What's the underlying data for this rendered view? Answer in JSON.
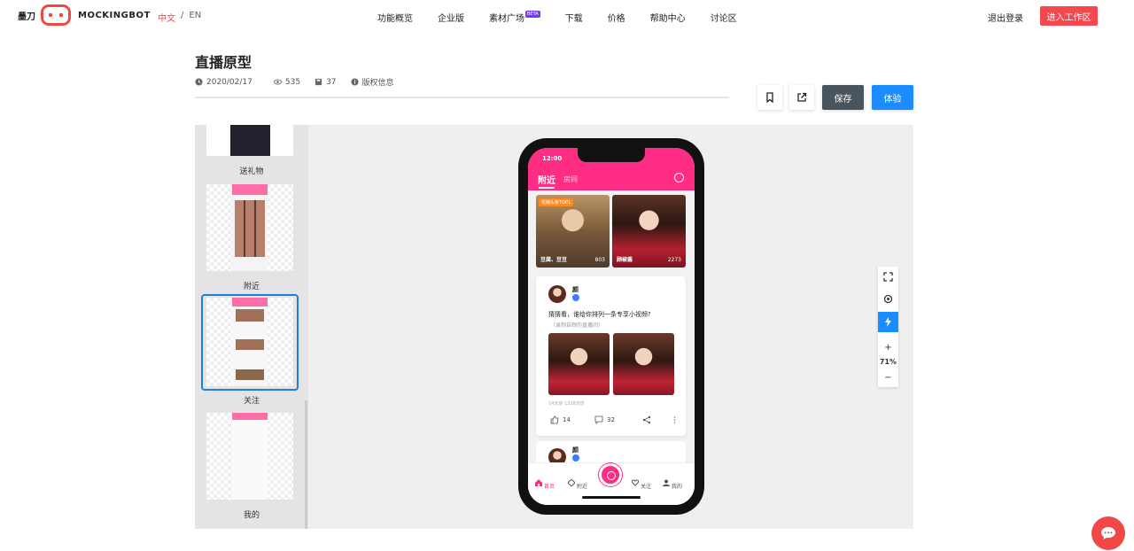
{
  "nav": {
    "logo_cn": "墨刀",
    "logo_en": "MOCKINGBOT",
    "lang_cn": "中文",
    "lang_sep": "/",
    "lang_en": "EN",
    "menu": [
      "功能概览",
      "企业版",
      "素材广场",
      "下载",
      "价格",
      "帮助中心",
      "讨论区"
    ],
    "beta": "BETA",
    "logout": "退出登录",
    "enter": "进入工作区"
  },
  "project": {
    "title": "直播原型",
    "date": "2020/02/17",
    "views": "535",
    "saves": "37",
    "copyright": "版权信息",
    "save_label": "保存",
    "try_label": "体验"
  },
  "sidebar": {
    "pages": [
      "送礼物",
      "附近",
      "关注",
      "我的"
    ],
    "selected": "关注"
  },
  "phone": {
    "time": "12:00",
    "tab_active": "附近",
    "tab_other": "房间",
    "hot_badge": "花椒头条TOP1",
    "card1_name": "豆腐、豆豆",
    "card1_count": "803",
    "card2_name": "顾椒酱",
    "card2_count": "2273",
    "post_user": "颜",
    "post_text": "猜猜看，谁给你排列一条专享小视频?",
    "post_sub": "（录制自颜的直播间）",
    "post_info": "14天前·1328浏览",
    "likes": "14",
    "comments": "32",
    "post2_user": "颜",
    "tabs": [
      "首页",
      "附近",
      "关注",
      "我的"
    ]
  },
  "zoom": {
    "plus": "+",
    "minus": "−",
    "percent": "71%"
  },
  "colors": {
    "brand": "#f24747",
    "pink": "#ff2d83",
    "blue": "#1a8cff",
    "save": "#4a545c"
  }
}
